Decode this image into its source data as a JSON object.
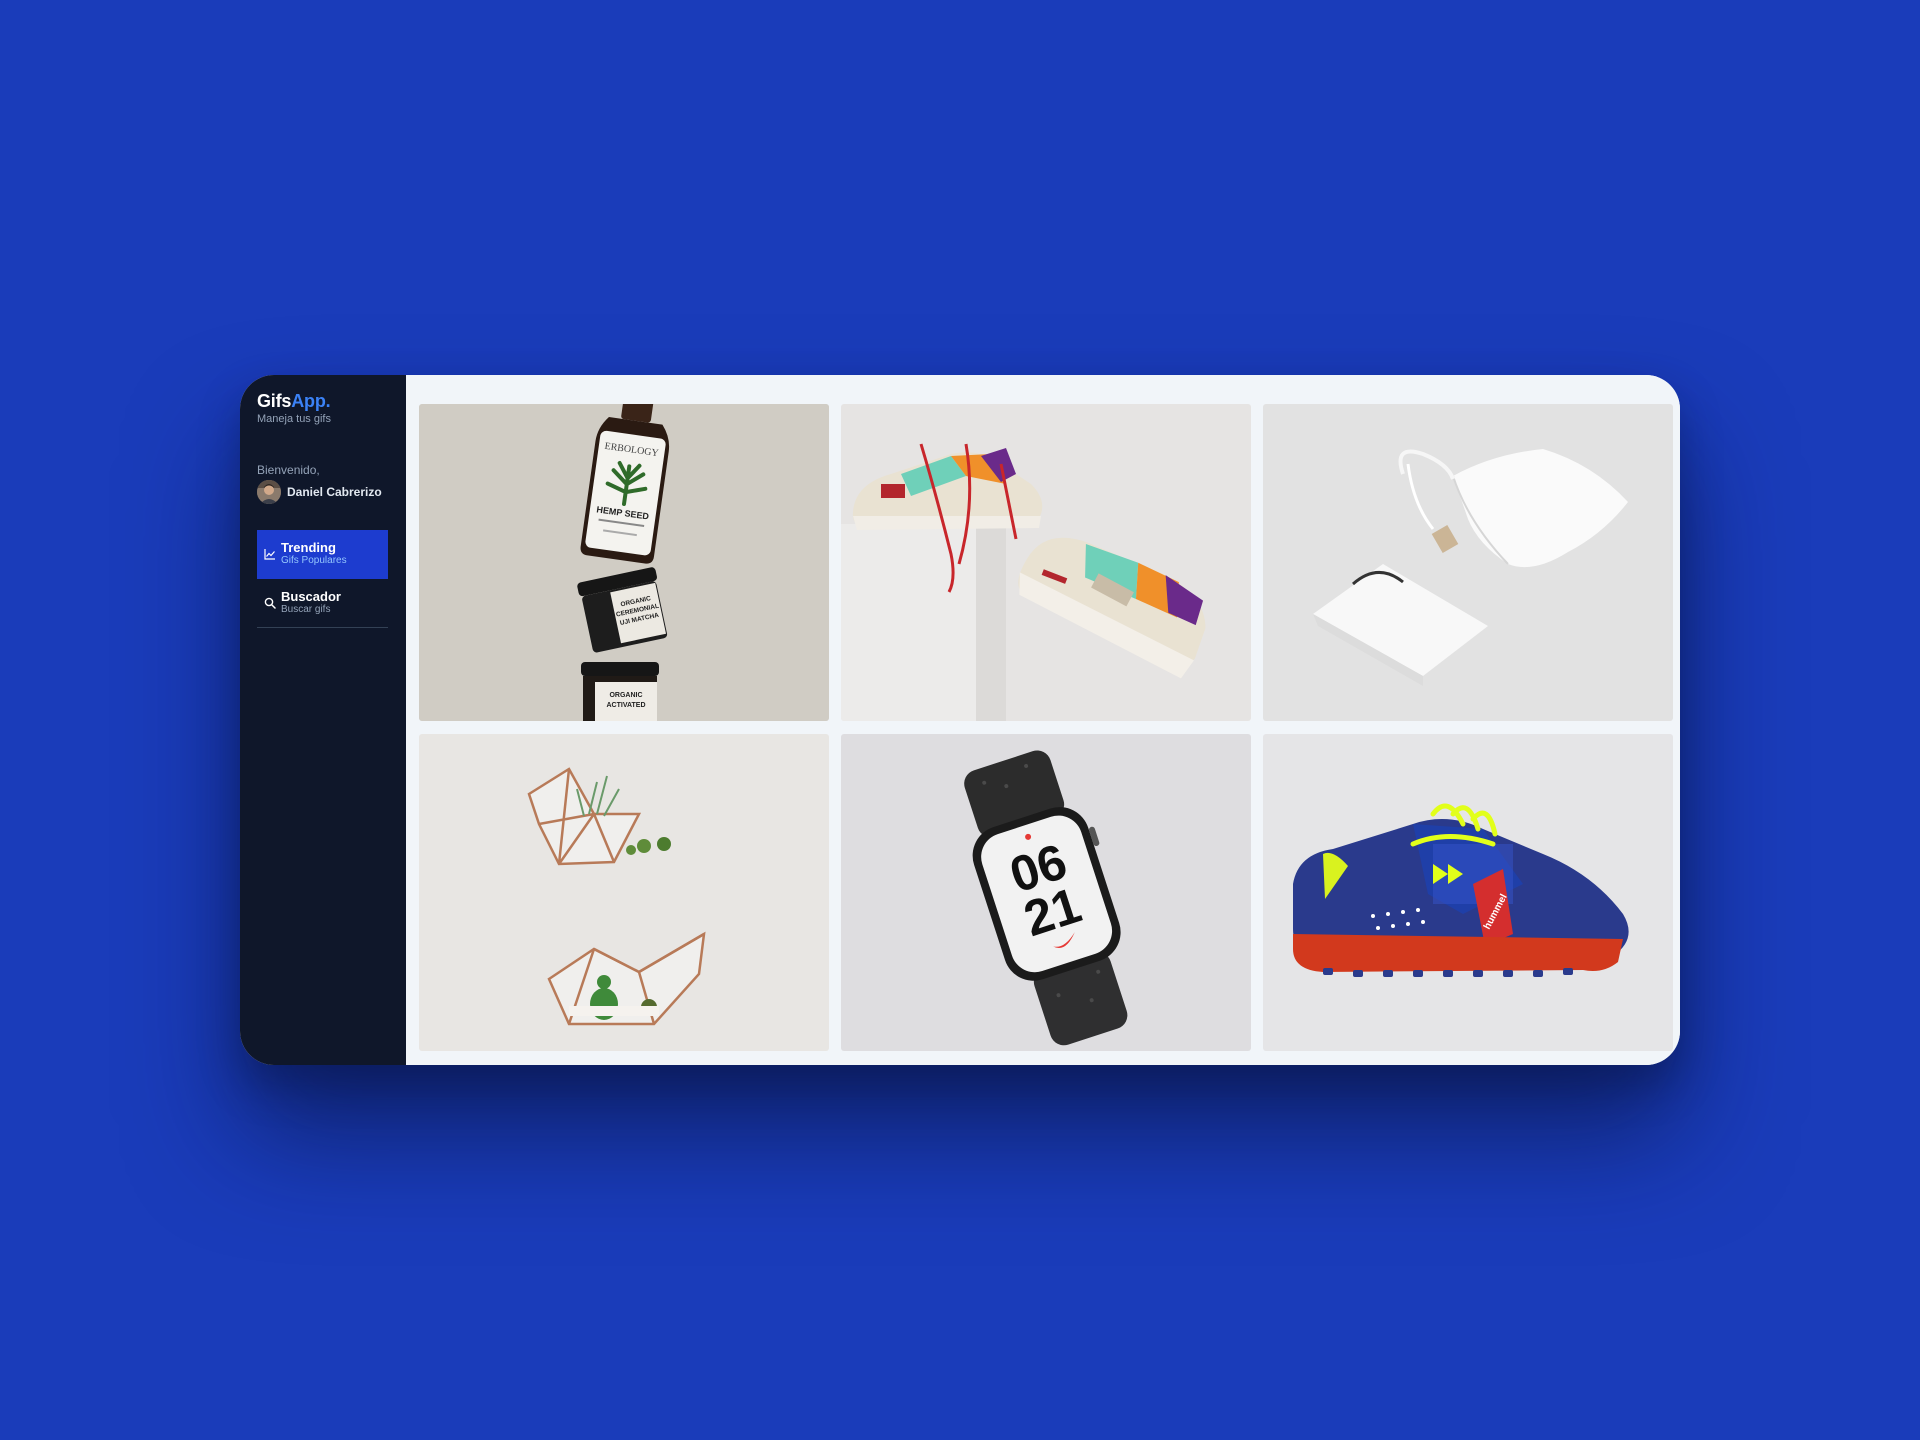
{
  "app": {
    "brand_main": "Gifs",
    "brand_accent": "App.",
    "tagline": "Maneja tus gifs"
  },
  "user": {
    "welcome": "Bienvenido,",
    "name": "Daniel Cabrerizo"
  },
  "nav": [
    {
      "label": "Trending",
      "sub": "Gifs Populares",
      "icon": "chart-line-icon",
      "active": true
    },
    {
      "label": "Buscador",
      "sub": "Buscar gifs",
      "icon": "search-icon",
      "active": false
    }
  ],
  "gallery": {
    "items": [
      {
        "subject": "hemp-seed-bottles"
      },
      {
        "subject": "sneakers"
      },
      {
        "subject": "white-bags"
      },
      {
        "subject": "glass-terrariums"
      },
      {
        "subject": "smartwatch"
      },
      {
        "subject": "football-shoe"
      }
    ],
    "photo_text": {
      "bottle_brand": "ERBOLOGY",
      "bottle_product": "HEMP SEED",
      "jar1_line1": "ORGANIC",
      "jar1_line2": "CEREMONIAL",
      "jar1_line3": "UJI MATCHA",
      "jar2_line1": "ORGANIC",
      "jar2_line2": "ACTIVATED",
      "watch_line1": "06",
      "watch_line2": "21",
      "shoe_brand": "hummel"
    }
  },
  "colors": {
    "background": "#1a3cba",
    "sidebar": "#0f172a",
    "accent": "#3b82f6",
    "active_nav": "#1d3ccf",
    "content": "#f1f5f9"
  }
}
